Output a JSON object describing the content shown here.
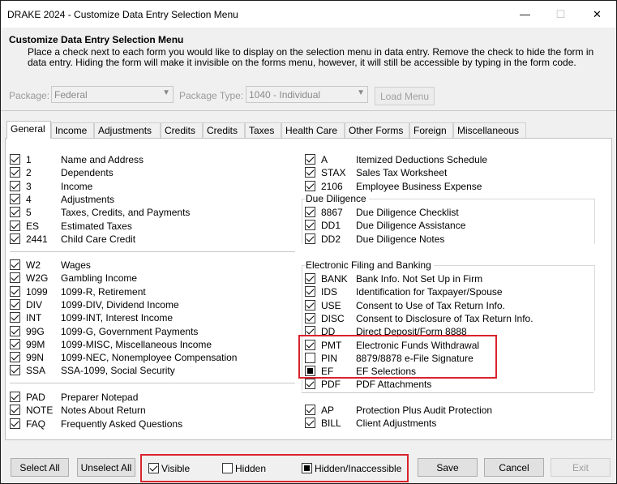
{
  "window": {
    "title": "DRAKE 2024 - Customize Data Entry Selection Menu",
    "minimize": "—",
    "maximize": "☐",
    "close": "✕"
  },
  "header": {
    "title": "Customize Data Entry Selection Menu",
    "description": "Place a check next to each form you would like to display on the selection menu in data entry.  Remove the check to hide the form in data entry.  Hiding the form will make it invisible on the forms menu, however, it will still be accessible by typing in the form code."
  },
  "package": {
    "label": "Package:",
    "value": "Federal"
  },
  "package_type": {
    "label": "Package Type:",
    "value": "1040 - Individual"
  },
  "load_menu_label": "Load Menu",
  "tabs": [
    "General",
    "Income",
    "Adjustments",
    "Credits",
    "Credits",
    "Taxes",
    "Health Care",
    "Other Forms",
    "Foreign",
    "Miscellaneous"
  ],
  "left_group1": [
    {
      "code": "1",
      "desc": "Name and Address",
      "state": "checked"
    },
    {
      "code": "2",
      "desc": "Dependents",
      "state": "checked"
    },
    {
      "code": "3",
      "desc": "Income",
      "state": "checked"
    },
    {
      "code": "4",
      "desc": "Adjustments",
      "state": "checked"
    },
    {
      "code": "5",
      "desc": "Taxes, Credits, and Payments",
      "state": "checked"
    },
    {
      "code": "ES",
      "desc": "Estimated Taxes",
      "state": "checked"
    },
    {
      "code": "2441",
      "desc": "Child Care Credit",
      "state": "checked"
    }
  ],
  "left_group2": [
    {
      "code": "W2",
      "desc": "Wages",
      "state": "checked"
    },
    {
      "code": "W2G",
      "desc": "Gambling Income",
      "state": "checked"
    },
    {
      "code": "1099",
      "desc": "1099-R, Retirement",
      "state": "checked"
    },
    {
      "code": "DIV",
      "desc": "1099-DIV, Dividend Income",
      "state": "checked"
    },
    {
      "code": "INT",
      "desc": "1099-INT, Interest Income",
      "state": "checked"
    },
    {
      "code": "99G",
      "desc": "1099-G, Government Payments",
      "state": "checked"
    },
    {
      "code": "99M",
      "desc": "1099-MISC, Miscellaneous Income",
      "state": "checked"
    },
    {
      "code": "99N",
      "desc": "1099-NEC, Nonemployee Compensation",
      "state": "checked"
    },
    {
      "code": "SSA",
      "desc": "SSA-1099, Social Security",
      "state": "checked"
    }
  ],
  "left_group3": [
    {
      "code": "PAD",
      "desc": "Preparer Notepad",
      "state": "checked"
    },
    {
      "code": "NOTE",
      "desc": "Notes About Return",
      "state": "checked"
    },
    {
      "code": "FAQ",
      "desc": "Frequently Asked Questions",
      "state": "checked"
    }
  ],
  "right_group1": [
    {
      "code": "A",
      "desc": "Itemized Deductions Schedule",
      "state": "checked"
    },
    {
      "code": "STAX",
      "desc": "Sales Tax Worksheet",
      "state": "checked"
    },
    {
      "code": "2106",
      "desc": "Employee Business Expense",
      "state": "checked"
    }
  ],
  "due_diligence": {
    "label": "Due Diligence",
    "items": [
      {
        "code": "8867",
        "desc": "Due Diligence Checklist",
        "state": "checked"
      },
      {
        "code": "DD1",
        "desc": "Due Diligence Assistance",
        "state": "checked"
      },
      {
        "code": "DD2",
        "desc": "Due Diligence Notes",
        "state": "checked"
      }
    ]
  },
  "efile": {
    "label": "Electronic Filing and Banking",
    "items": [
      {
        "code": "BANK",
        "desc": "Bank Info. Not Set Up in Firm",
        "state": "checked"
      },
      {
        "code": "IDS",
        "desc": "Identification for Taxpayer/Spouse",
        "state": "checked"
      },
      {
        "code": "USE",
        "desc": "Consent to Use of Tax Return Info.",
        "state": "checked"
      },
      {
        "code": "DISC",
        "desc": "Consent to Disclosure of Tax Return Info.",
        "state": "checked"
      },
      {
        "code": "DD",
        "desc": "Direct Deposit/Form 8888",
        "state": "checked"
      },
      {
        "code": "PMT",
        "desc": "Electronic Funds Withdrawal",
        "state": "checked"
      },
      {
        "code": "PIN",
        "desc": "8879/8878 e-File Signature",
        "state": "unchecked"
      },
      {
        "code": "EF",
        "desc": "EF Selections",
        "state": "partial"
      },
      {
        "code": "PDF",
        "desc": "PDF Attachments",
        "state": "checked"
      }
    ]
  },
  "right_group3": [
    {
      "code": "AP",
      "desc": "Protection Plus Audit Protection",
      "state": "checked"
    },
    {
      "code": "BILL",
      "desc": "Client Adjustments",
      "state": "checked"
    }
  ],
  "footer": {
    "select_all": "Select All",
    "unselect_all": "Unselect All",
    "legend_visible": "Visible",
    "legend_hidden": "Hidden",
    "legend_hidden_inaccessible": "Hidden/Inaccessible",
    "save": "Save",
    "cancel": "Cancel",
    "exit": "Exit"
  },
  "accent": {
    "highlight_box": "#d9232d"
  }
}
